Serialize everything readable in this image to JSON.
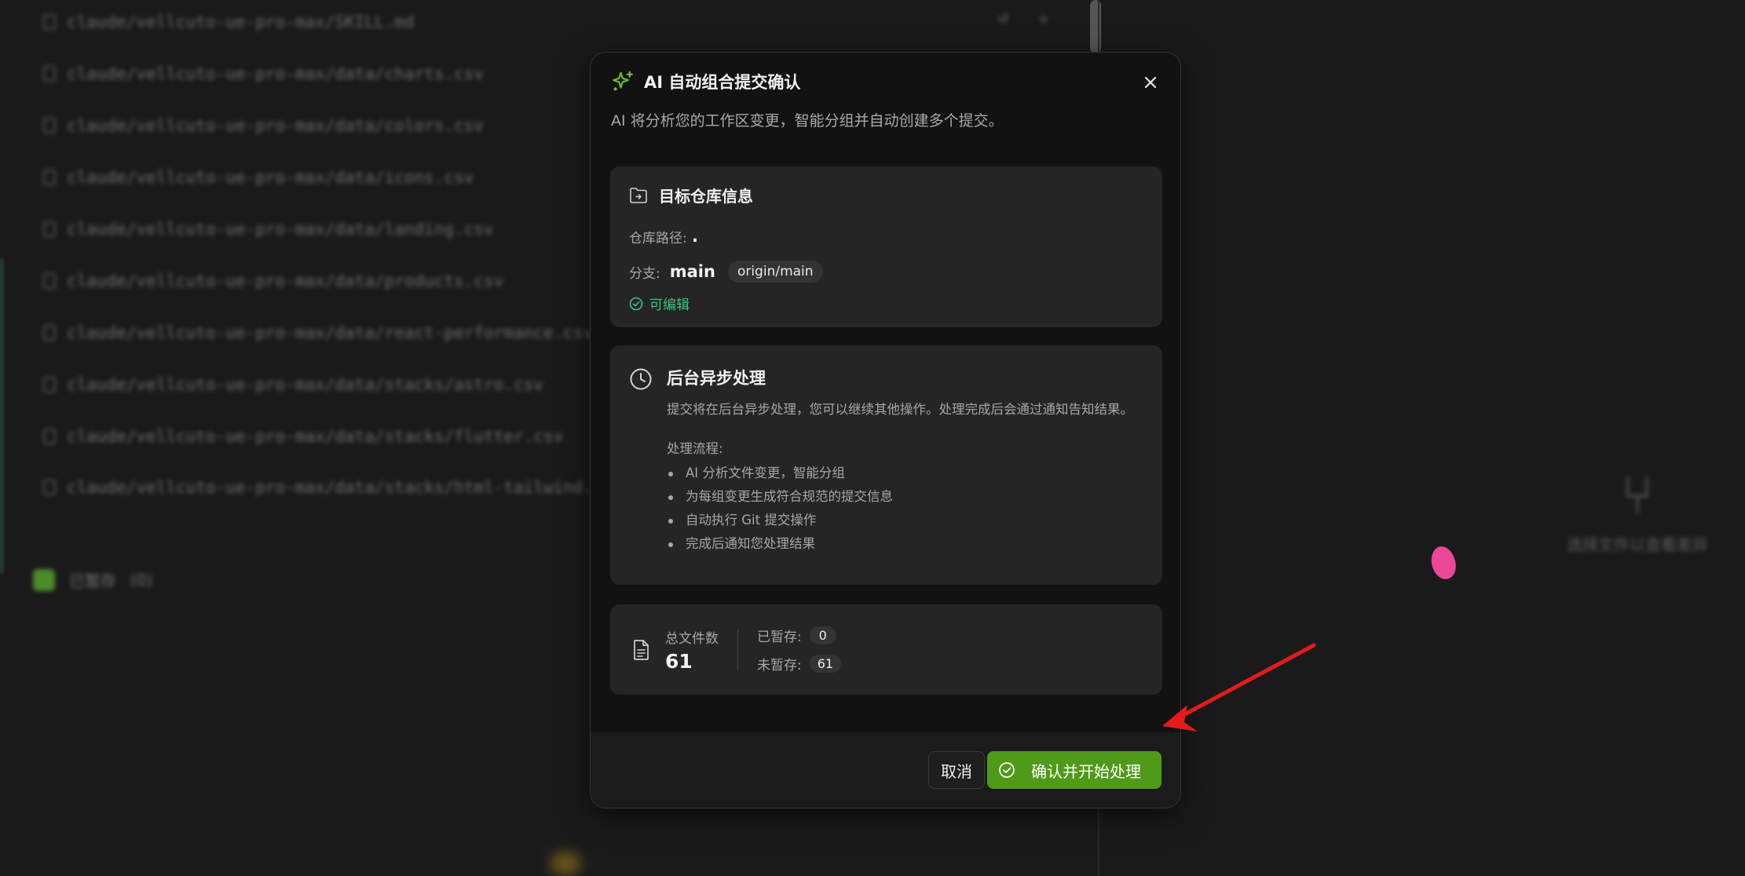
{
  "background": {
    "file_rows": [
      "claude/vellcuto-ue-pro-max/SKILL.md",
      "claude/vellcuto-ue-pro-max/data/charts.csv",
      "claude/vellcuto-ue-pro-max/data/colors.csv",
      "claude/vellcuto-ue-pro-max/data/icons.csv",
      "claude/vellcuto-ue-pro-max/data/landing.csv",
      "claude/vellcuto-ue-pro-max/data/products.csv",
      "claude/vellcuto-ue-pro-max/data/react-performance.csv",
      "claude/vellcuto-ue-pro-max/data/stacks/astro.csv",
      "claude/vellcuto-ue-pro-max/data/stacks/flutter.csv",
      "claude/vellcuto-ue-pro-max/data/stacks/html-tailwind.csv"
    ],
    "staged_label": "已暂存",
    "staged_count": "(0)",
    "empty_text": "选择文件以查看差异"
  },
  "dialog": {
    "title": "AI 自动组合提交确认",
    "description": "AI 将分析您的工作区变更，智能分组并自动创建多个提交。",
    "repo_card": {
      "title": "目标仓库信息",
      "path_label": "仓库路径:",
      "path_value": ".",
      "branch_label": "分支:",
      "branch_value": "main",
      "remote_branch": "origin/main",
      "editable_label": "可编辑"
    },
    "async_card": {
      "title": "后台异步处理",
      "text": "提交将在后台异步处理，您可以继续其他操作。处理完成后会通过通知告知结果。",
      "flow_label": "处理流程:",
      "steps": [
        "AI 分析文件变更，智能分组",
        "为每组变更生成符合规范的提交信息",
        "自动执行 Git 提交操作",
        "完成后通知您处理结果"
      ]
    },
    "stats_card": {
      "total_label": "总文件数",
      "total_value": "61",
      "staged_label": "已暂存:",
      "staged_value": "0",
      "unstaged_label": "未暂存:",
      "unstaged_value": "61"
    },
    "cancel_label": "取消",
    "confirm_label": "确认并开始处理"
  },
  "colors": {
    "accent": "#4f9a18",
    "success": "#3cc47a",
    "annotation_arrow": "#e31b1b"
  }
}
